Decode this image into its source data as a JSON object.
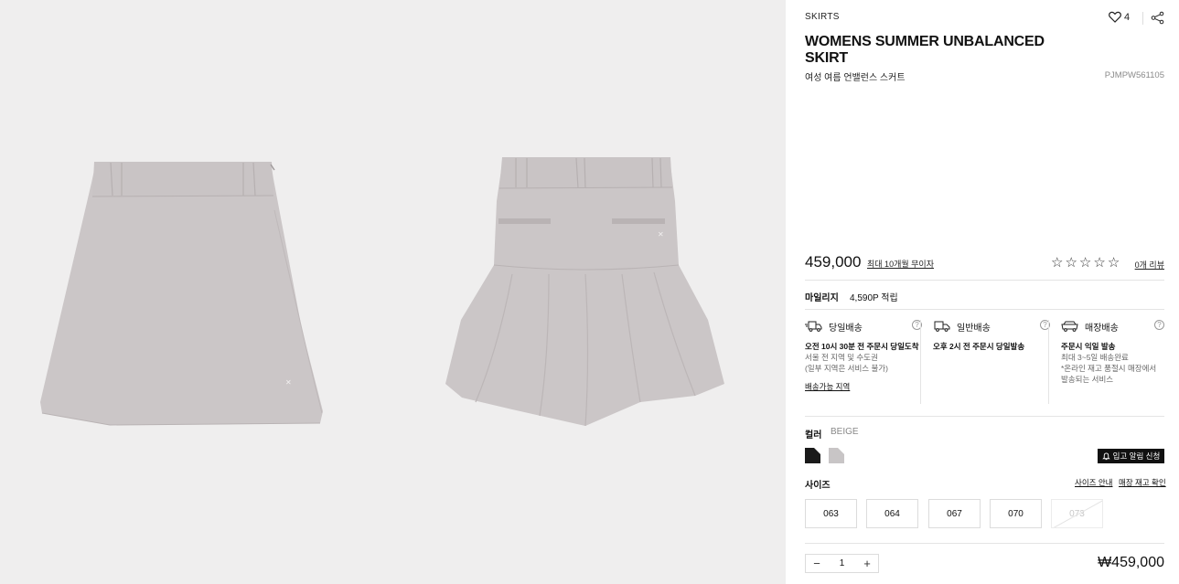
{
  "product": {
    "category": "SKIRTS",
    "wish_count": "4",
    "title": "WOMENS SUMMER UNBALANCED SKIRT",
    "subtitle_ko": "여성 여름 언밸런스 스커트",
    "code": "PJMPW561105",
    "price": "459,000",
    "installment_link": "최대 10개월 무이자",
    "stars": [
      "☆",
      "☆",
      "☆",
      "☆",
      "☆"
    ],
    "reviews_link": "0개 리뷰"
  },
  "mileage": {
    "label": "마일리지",
    "value": "4,590P 적립"
  },
  "shipping": [
    {
      "title": "당일배송",
      "icon": "truck-fast-icon",
      "bold": "오전 10시 30분 전 주문시 당일도착",
      "sub": [
        "서울 전 지역 및 수도권",
        "(일부 지역은 서비스 불가)"
      ],
      "link": "배송가능 지역"
    },
    {
      "title": "일반배송",
      "icon": "truck-icon",
      "bold": "오후 2시 전 주문시 당일발송",
      "sub": [],
      "link": ""
    },
    {
      "title": "매장배송",
      "icon": "store-delivery-icon",
      "bold": "주문시 익일 발송",
      "sub": [
        "최대 3~5일 배송완료",
        "*온라인 재고 품절시 매장에서",
        "발송되는 서비스"
      ],
      "link": ""
    }
  ],
  "color": {
    "label": "컬러",
    "selected": "BEIGE",
    "swatches": [
      {
        "name": "black",
        "hex": "#1a1a1a"
      },
      {
        "name": "beige",
        "hex": "#c8c5c6"
      }
    ],
    "notify_label": "입고 알림 신청"
  },
  "size": {
    "label": "사이즈",
    "guide_link": "사이즈 안내",
    "stock_link": "매장 재고 확인",
    "options": [
      "063",
      "064",
      "067",
      "070",
      "073"
    ],
    "sold_out": [
      "073"
    ]
  },
  "quantity": {
    "minus": "−",
    "value": "1",
    "plus": "+"
  },
  "total": "₩459,000",
  "colors": {
    "skirt": "#cbc6c7",
    "skirt_shade": "#bdb7b8",
    "gallery_bg": "#efeeee"
  }
}
